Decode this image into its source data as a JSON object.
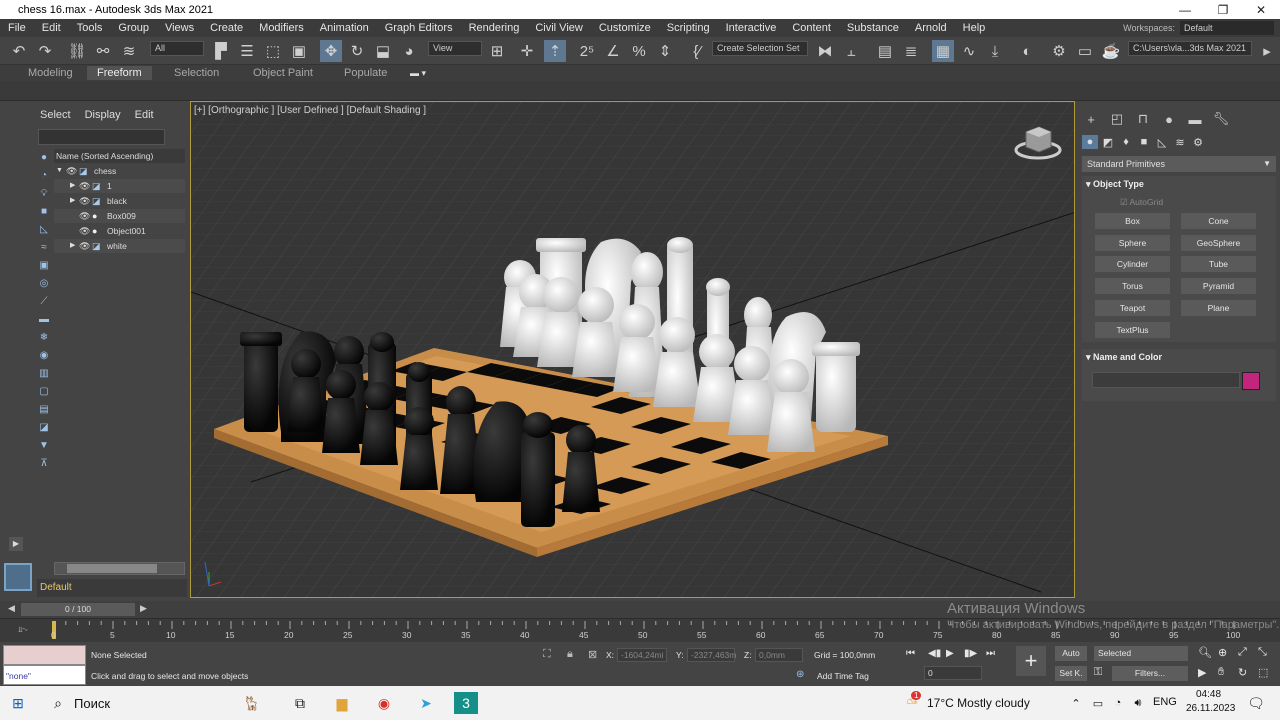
{
  "window": {
    "title": "chess 16.max - Autodesk 3ds Max 2021",
    "min": "—",
    "max": "❐",
    "close": "✕"
  },
  "menu": [
    "File",
    "Edit",
    "Tools",
    "Group",
    "Views",
    "Create",
    "Modifiers",
    "Animation",
    "Graph Editors",
    "Rendering",
    "Civil View",
    "Customize",
    "Scripting",
    "Interactive",
    "Content",
    "Substance",
    "Arnold",
    "Help"
  ],
  "workspaces": {
    "label": "Workspaces:",
    "value": "Default"
  },
  "toolbar": {
    "selection_filter": "All",
    "ref_coord": "View",
    "named_selection": "Create Selection Set",
    "project_path": "C:\\Users\\vla...3ds Max 2021"
  },
  "ribbon_tabs": [
    "Modeling",
    "Freeform",
    "Selection",
    "Object Paint",
    "Populate"
  ],
  "scene_explorer": {
    "tabs": [
      "Select",
      "Display",
      "Edit"
    ],
    "column_header": "Name (Sorted Ascending)",
    "rows": [
      {
        "name": "chess"
      },
      {
        "name": "1"
      },
      {
        "name": "black"
      },
      {
        "name": "Box009"
      },
      {
        "name": "Object001"
      },
      {
        "name": "white"
      }
    ],
    "layer": "Default"
  },
  "viewport": {
    "label": "[+] [Orthographic ] [User Defined ] [Default Shading ]"
  },
  "command_panel": {
    "category": "Standard Primitives",
    "object_type_header": "Object Type",
    "autogrid": "AutoGrid",
    "primitives": [
      "Box",
      "Cone",
      "Sphere",
      "GeoSphere",
      "Cylinder",
      "Tube",
      "Torus",
      "Pyramid",
      "Teapot",
      "Plane",
      "TextPlus"
    ],
    "name_color_header": "Name and Color",
    "color": "#c2257e"
  },
  "time": {
    "frame": "0 / 100",
    "ticks": [
      "0",
      "5",
      "10",
      "15",
      "20",
      "25",
      "30",
      "35",
      "40",
      "45",
      "50",
      "55",
      "60",
      "65",
      "70",
      "75",
      "80",
      "85",
      "90",
      "95",
      "100"
    ]
  },
  "status": {
    "maxscript": "\"none\"",
    "selected": "None Selected",
    "prompt": "Click and drag to select and move objects",
    "x_label": "X:",
    "x": "-1604,24mi",
    "y_label": "Y:",
    "y": "-2327,463m",
    "z_label": "Z:",
    "z": "0,0mm",
    "grid": "Grid = 100,0mm",
    "add_time_tag": "Add Time Tag",
    "auto": "Auto",
    "selected_dd": "Selected",
    "setk": "Set K.",
    "filters": "Filters...",
    "frame_field": "0"
  },
  "activation": {
    "title": "Активация Windows",
    "line": "Чтобы активировать Windows, перейдите в раздел \"Параметры\"."
  },
  "taskbar": {
    "search": "Поиск",
    "weather": "17°C  Mostly cloudy",
    "lang": "ENG",
    "time": "04:48",
    "date": "26.11.2023",
    "notif": "1"
  }
}
